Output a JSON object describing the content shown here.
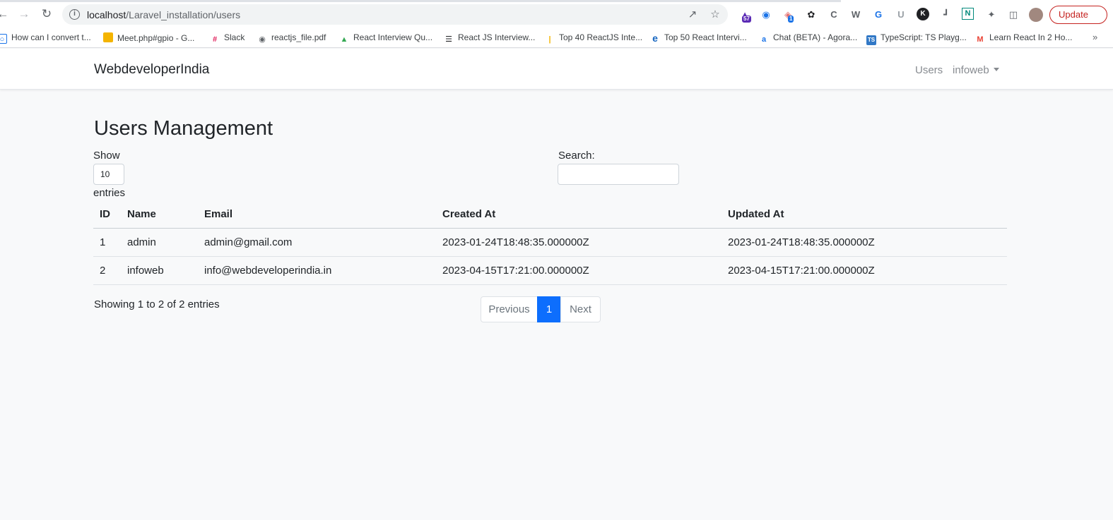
{
  "browser": {
    "url_host": "localhost",
    "url_path": "/Laravel_installation/users",
    "update_label": "Update",
    "ext_badge_1": "57",
    "ext_badge_2": "1",
    "bookmarks": [
      "How can I convert t...",
      "Meet.php#gpio - G...",
      "Slack",
      "reactjs_file.pdf",
      "React Interview Qu...",
      "React JS Interview...",
      "Top 40 ReactJS Inte...",
      "Top 50 React Intervi...",
      "Chat (BETA) - Agora...",
      "TypeScript: TS Playg...",
      "Learn React In 2 Ho..."
    ]
  },
  "navbar": {
    "brand": "WebdeveloperIndia",
    "users_link": "Users",
    "user_menu": "infoweb"
  },
  "main": {
    "title": "Users Management",
    "show_label": "Show",
    "page_length": "10",
    "entries_label": "entries",
    "search_label": "Search:",
    "table": {
      "columns": [
        "ID",
        "Name",
        "Email",
        "Created At",
        "Updated At"
      ],
      "rows": [
        [
          "1",
          "admin",
          "admin@gmail.com",
          "2023-01-24T18:48:35.000000Z",
          "2023-01-24T18:48:35.000000Z"
        ],
        [
          "2",
          "infoweb",
          "info@webdeveloperindia.in",
          "2023-04-15T17:21:00.000000Z",
          "2023-04-15T17:21:00.000000Z"
        ]
      ]
    },
    "info": "Showing 1 to 2 of 2 entries",
    "pagination": {
      "previous": "Previous",
      "current": "1",
      "next": "Next"
    }
  },
  "colors": {
    "accent": "#0d6efd",
    "update_red": "#c5221f",
    "page_bg": "#f8f9fa"
  }
}
